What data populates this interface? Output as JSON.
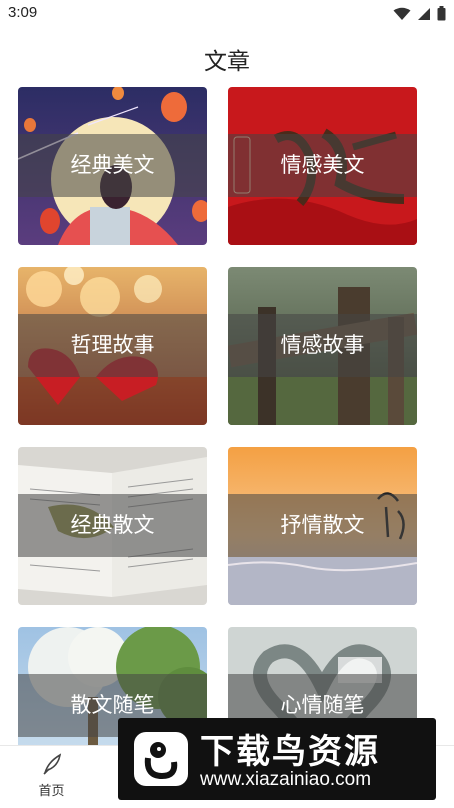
{
  "status_bar": {
    "time": "3:09",
    "icons": [
      "wifi-icon",
      "signal-icon",
      "battery-icon"
    ]
  },
  "page": {
    "title": "文章"
  },
  "categories": [
    {
      "label": "经典美文",
      "theme": "lanterns-moon"
    },
    {
      "label": "情感美文",
      "theme": "red-calligraphy"
    },
    {
      "label": "哲理故事",
      "theme": "hearts-bokeh"
    },
    {
      "label": "情感故事",
      "theme": "wooden-fence"
    },
    {
      "label": "经典散文",
      "theme": "open-book"
    },
    {
      "label": "抒情散文",
      "theme": "sunset-sea"
    },
    {
      "label": "散文随笔",
      "theme": "blossom-tree"
    },
    {
      "label": "心情随笔",
      "theme": "heart-sculpture"
    }
  ],
  "bottom_nav": {
    "items": [
      {
        "label": "首页",
        "icon": "feather-icon"
      }
    ]
  },
  "watermark": {
    "title": "下载鸟资源",
    "url": "www.xiazainiao.com"
  },
  "colors": {
    "accent_red": "#c8181c",
    "band": "#464646",
    "text_dark": "#222222"
  }
}
